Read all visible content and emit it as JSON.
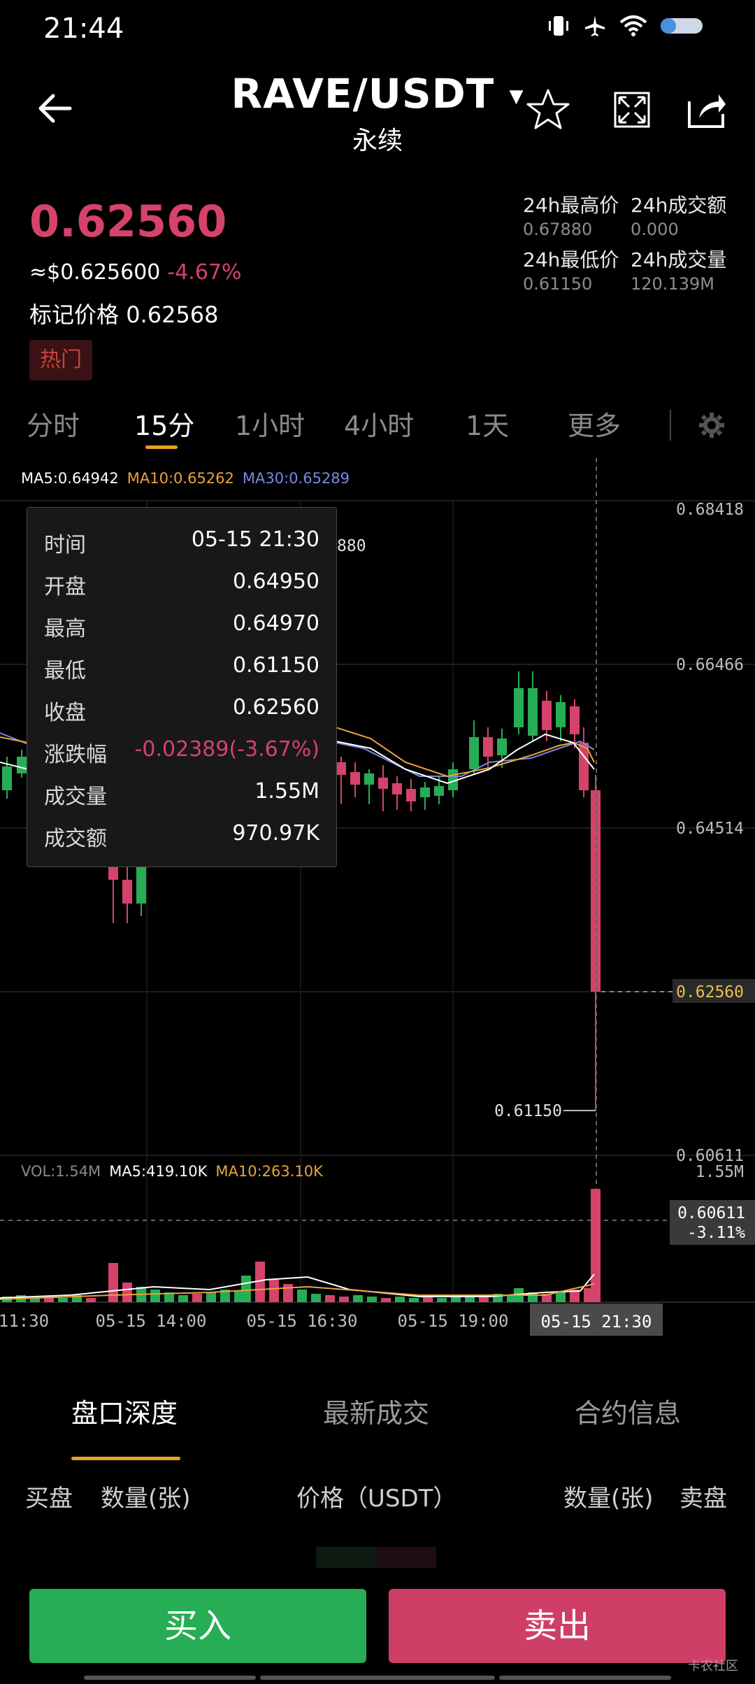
{
  "status": {
    "time": "21:44"
  },
  "header": {
    "pair": "RAVE/USDT",
    "subtitle": "永续"
  },
  "ticker": {
    "last_price": "0.62560",
    "usd_price": "≈$0.625600",
    "change_pct": "-4.67%",
    "mark_label": "标记价格",
    "mark_price": "0.62568",
    "badge": "热门",
    "stats": [
      {
        "label": "24h最高价",
        "value": "0.67880"
      },
      {
        "label": "24h成交额",
        "value": "0.000"
      },
      {
        "label": "24h最低价",
        "value": "0.61150"
      },
      {
        "label": "24h成交量",
        "value": "120.139M"
      }
    ]
  },
  "period_tabs": [
    "分时",
    "15分",
    "1小时",
    "4小时",
    "1天",
    "更多"
  ],
  "active_period": "15分",
  "chart": {
    "ma_legend": {
      "ma5": "MA5:0.64942",
      "ma10": "MA10:0.65262",
      "ma30": "MA30:0.65289"
    },
    "price_axis": [
      "0.68418",
      "0.66466",
      "0.64514",
      "0.62560",
      "0.60611"
    ],
    "high_marker_partial": "880",
    "low_marker": "0.61150",
    "vol_legend": {
      "vol": "VOL:1.54M",
      "ma5": "MA5:419.10K",
      "ma10": "MA10:263.10K"
    },
    "vol_axis_top": "1.55M",
    "cursor_price": "0.60611",
    "cursor_pct": "-3.11%",
    "time_axis": [
      "11:30",
      "05-15 14:00",
      "05-15 16:30",
      "05-15 19:00"
    ],
    "cursor_time": "05-15 21:30",
    "colors": {
      "up": "#27ad55",
      "down": "#d5436a",
      "ma5": "#ffffff",
      "ma10": "#e8a33a",
      "ma30": "#7b87e0"
    }
  },
  "tooltip": [
    {
      "k": "时间",
      "v": "05-15 21:30"
    },
    {
      "k": "开盘",
      "v": "0.64950"
    },
    {
      "k": "最高",
      "v": "0.64970"
    },
    {
      "k": "最低",
      "v": "0.61150"
    },
    {
      "k": "收盘",
      "v": "0.62560"
    },
    {
      "k": "涨跌幅",
      "v": "-0.02389(-3.67%)"
    },
    {
      "k": "成交量",
      "v": "1.55M"
    },
    {
      "k": "成交额",
      "v": "970.97K"
    }
  ],
  "bottom_tabs": [
    "盘口深度",
    "最新成交",
    "合约信息"
  ],
  "orderbook_headers": {
    "buy": "买盘",
    "qty_left": "数量(张)",
    "price": "价格（USDT）",
    "qty_right": "数量(张)",
    "sell": "卖盘"
  },
  "actions": {
    "buy": "买入",
    "sell": "卖出"
  },
  "watermark": "卡农社区"
}
